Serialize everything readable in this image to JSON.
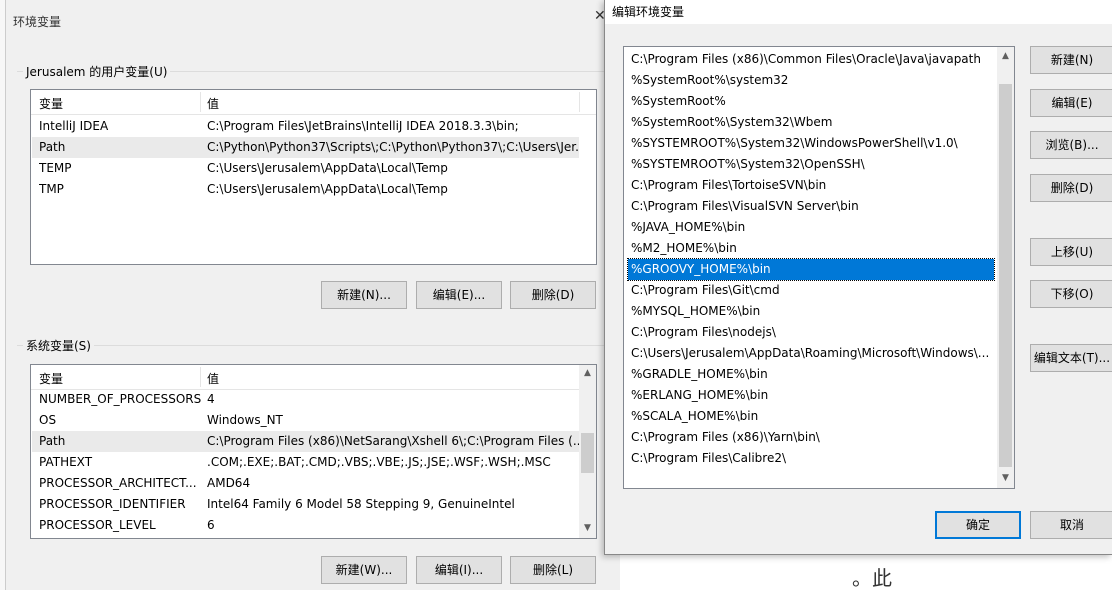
{
  "left_dialog": {
    "title": "环境变量",
    "user_group_label": "Jerusalem 的用户变量(U)",
    "columns": [
      "变量",
      "值"
    ],
    "user_vars": [
      {
        "name": "IntelliJ IDEA",
        "value": "C:\\Program Files\\JetBrains\\IntelliJ IDEA 2018.3.3\\bin;"
      },
      {
        "name": "Path",
        "value": "C:\\Python\\Python37\\Scripts\\;C:\\Python\\Python37\\;C:\\Users\\Jer..."
      },
      {
        "name": "TEMP",
        "value": "C:\\Users\\Jerusalem\\AppData\\Local\\Temp"
      },
      {
        "name": "TMP",
        "value": "C:\\Users\\Jerusalem\\AppData\\Local\\Temp"
      }
    ],
    "user_buttons": {
      "new": "新建(N)...",
      "edit": "编辑(E)...",
      "delete": "删除(D)"
    },
    "system_group_label": "系统变量(S)",
    "system_vars": [
      {
        "name": "NUMBER_OF_PROCESSORS",
        "value": "4"
      },
      {
        "name": "OS",
        "value": "Windows_NT"
      },
      {
        "name": "Path",
        "value": "C:\\Program Files (x86)\\NetSarang\\Xshell 6\\;C:\\Program Files (..."
      },
      {
        "name": "PATHEXT",
        "value": ".COM;.EXE;.BAT;.CMD;.VBS;.VBE;.JS;.JSE;.WSF;.WSH;.MSC"
      },
      {
        "name": "PROCESSOR_ARCHITECT...",
        "value": "AMD64"
      },
      {
        "name": "PROCESSOR_IDENTIFIER",
        "value": "Intel64 Family 6 Model 58 Stepping 9, GenuineIntel"
      },
      {
        "name": "PROCESSOR_LEVEL",
        "value": "6"
      }
    ],
    "system_buttons": {
      "new": "新建(W)...",
      "edit": "编辑(I)...",
      "delete": "删除(L)"
    }
  },
  "right_dialog": {
    "title": "编辑环境变量",
    "paths": [
      "C:\\Program Files (x86)\\Common Files\\Oracle\\Java\\javapath",
      "%SystemRoot%\\system32",
      "%SystemRoot%",
      "%SystemRoot%\\System32\\Wbem",
      "%SYSTEMROOT%\\System32\\WindowsPowerShell\\v1.0\\",
      "%SYSTEMROOT%\\System32\\OpenSSH\\",
      "C:\\Program Files\\TortoiseSVN\\bin",
      "C:\\Program Files\\VisualSVN Server\\bin",
      "%JAVA_HOME%\\bin",
      "%M2_HOME%\\bin",
      "%GROOVY_HOME%\\bin",
      "C:\\Program Files\\Git\\cmd",
      "%MYSQL_HOME%\\bin",
      "C:\\Program Files\\nodejs\\",
      "C:\\Users\\Jerusalem\\AppData\\Roaming\\Microsoft\\Windows\\...",
      "%GRADLE_HOME%\\bin",
      "%ERLANG_HOME%\\bin",
      "%SCALA_HOME%\\bin",
      "C:\\Program Files (x86)\\Yarn\\bin\\",
      "C:\\Program Files\\Calibre2\\"
    ],
    "selected_path": "%GROOVY_HOME%\\bin",
    "buttons": {
      "new": "新建(N)",
      "edit": "编辑(E)",
      "browse": "浏览(B)...",
      "delete": "删除(D)",
      "move_up": "上移(U)",
      "move_down": "下移(O)",
      "edit_text": "编辑文本(T)...",
      "ok": "确定",
      "cancel": "取消"
    }
  },
  "background": {
    "fragment_text": "。此"
  },
  "colors": {
    "dialog_bg": "#f0f0f0",
    "selection": "#0078d7",
    "row_highlight": "#eaeaea"
  }
}
